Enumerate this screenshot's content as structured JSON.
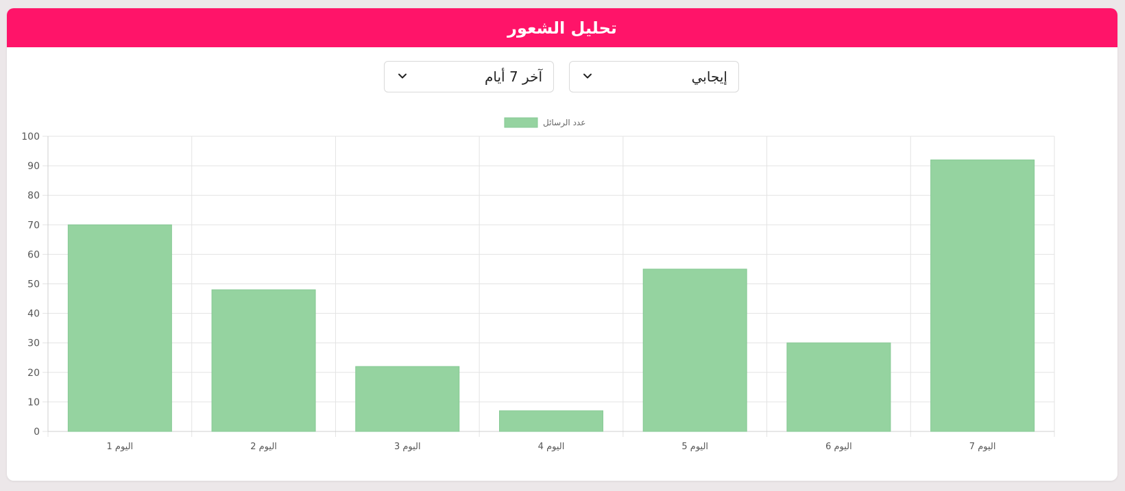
{
  "header": {
    "title": "تحليل الشعور"
  },
  "filters": {
    "sentiment": {
      "value": "إيجابي"
    },
    "time_range": {
      "value": "آخر 7 أيام"
    }
  },
  "colors": {
    "header_bg": "#ff1469",
    "bar_fill": "#95d3a0"
  },
  "chart_data": {
    "type": "bar",
    "categories": [
      "اليوم 1",
      "اليوم 2",
      "اليوم 3",
      "اليوم 4",
      "اليوم 5",
      "اليوم 6",
      "اليوم 7"
    ],
    "series": [
      {
        "name": "عدد الرسائل",
        "values": [
          70,
          48,
          22,
          7,
          55,
          30,
          92
        ]
      }
    ],
    "ylim": [
      0,
      100
    ],
    "yticks": [
      0,
      10,
      20,
      30,
      40,
      50,
      60,
      70,
      80,
      90,
      100
    ],
    "grid": true,
    "legend": "top-center"
  }
}
